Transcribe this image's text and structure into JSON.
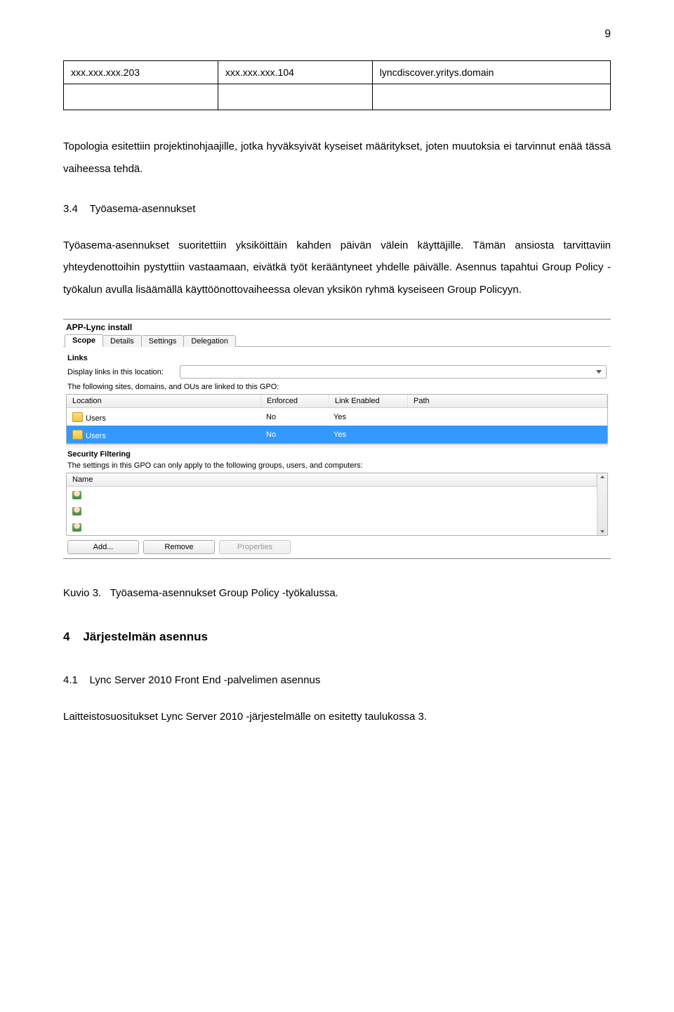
{
  "page_num": "9",
  "table": {
    "r1c1": "xxx.xxx.xxx.203",
    "r1c2": "xxx.xxx.xxx.104",
    "r1c3": "lyncdiscover.yritys.domain"
  },
  "para1": "Topologia esitettiin projektinohjaajille, jotka hyväksyivät kyseiset määritykset, joten muutoksia ei tarvinnut enää tässä vaiheessa tehdä.",
  "sect34": "3.4    Työasema-asennukset",
  "para2": "Työasema-asennukset suoritettiin yksiköittäin kahden päivän välein käyttäjille. Tämän ansiosta tarvittaviin yhteydenottoihin pystyttiin vastaamaan, eivätkä työt kerääntyneet yhdelle päivälle. Asennus tapahtui Group Policy -työkalun avulla lisäämällä käyttöönottovaiheessa olevan yksikön ryhmä kyseiseen Group Policyyn.",
  "gpo": {
    "title": "APP-Lync install",
    "tabs": [
      "Scope",
      "Details",
      "Settings",
      "Delegation"
    ],
    "links_section": "Links",
    "links_field_label": "Display links in this location:",
    "links_note": "The following sites, domains, and OUs are linked to this GPO:",
    "cols": {
      "location": "Location",
      "enforced": "Enforced",
      "linkEnabled": "Link Enabled",
      "path": "Path"
    },
    "rows": [
      {
        "location": "Users",
        "enforced": "No",
        "linkEnabled": "Yes",
        "path": ""
      },
      {
        "location": "Users",
        "enforced": "No",
        "linkEnabled": "Yes",
        "path": ""
      }
    ],
    "sf_section": "Security Filtering",
    "sf_note": "The settings in this GPO can only apply to the following groups, users, and computers:",
    "sf_col": "Name",
    "buttons": {
      "add": "Add...",
      "remove": "Remove",
      "props": "Properties"
    }
  },
  "caption": "Kuvio 3.   Työasema-asennukset Group Policy -työkalussa.",
  "h4": "4    Järjestelmän asennus",
  "sect41": "4.1    Lync Server 2010 Front End -palvelimen asennus",
  "para3": "Laitteistosuositukset Lync Server 2010 -järjestelmälle on esitetty taulukossa 3."
}
